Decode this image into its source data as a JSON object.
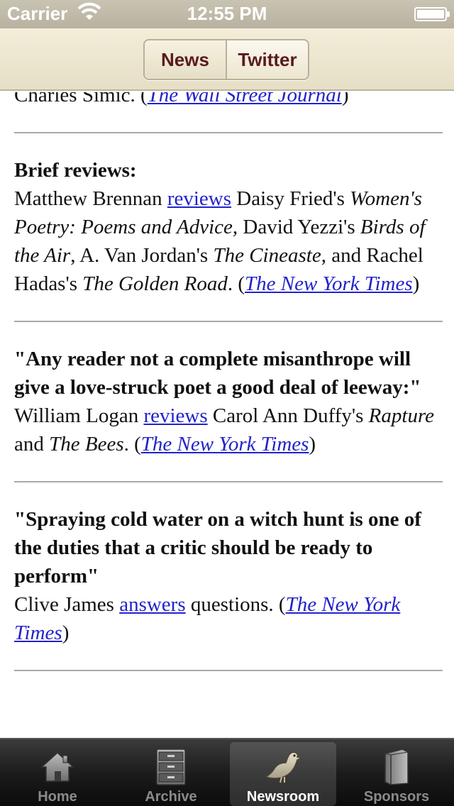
{
  "status": {
    "carrier": "Carrier",
    "time": "12:55 PM"
  },
  "segmented": {
    "news": "News",
    "twitter": "Twitter"
  },
  "entries": [
    {
      "pre": "Charles Simic. (",
      "source": "The Wall Street Journal",
      "post": ")"
    },
    {
      "headline": "Brief reviews:",
      "author": "Matthew Brennan ",
      "link": "reviews",
      "t1": " Daisy Fried's ",
      "b1": "Women's Poetry: Poems and Advice,",
      "t2": " David Yezzi's ",
      "b2": "Birds of the Air",
      "t3": ", A. Van Jordan's ",
      "b3": "The Cineaste",
      "t4": ", and Rachel Hadas's ",
      "b4": "The Golden Road",
      "t5": ". (",
      "source": "The New York Times",
      "post": ")"
    },
    {
      "headline": "\"Any reader not a complete misanthrope will give a love-struck poet a good deal of leeway:\"",
      "author": "William Logan ",
      "link": "reviews",
      "t1": " Carol Ann Duffy's ",
      "b1": "Rapture",
      "t2": " and ",
      "b2": "The Bees",
      "t3": ". (",
      "source": "The New York Times",
      "post": ")"
    },
    {
      "headline": "\"Spraying cold water on a witch hunt is one of the duties that a critic should be ready to perform\"",
      "author": "Clive James ",
      "link": "answers",
      "t1": " questions. (",
      "source": "The New York Times",
      "post": ")"
    }
  ],
  "tabs": [
    {
      "label": "Home",
      "icon": "home-icon"
    },
    {
      "label": "Archive",
      "icon": "archive-icon"
    },
    {
      "label": "Newsroom",
      "icon": "pigeon-icon"
    },
    {
      "label": "Sponsors",
      "icon": "book-icon"
    }
  ]
}
